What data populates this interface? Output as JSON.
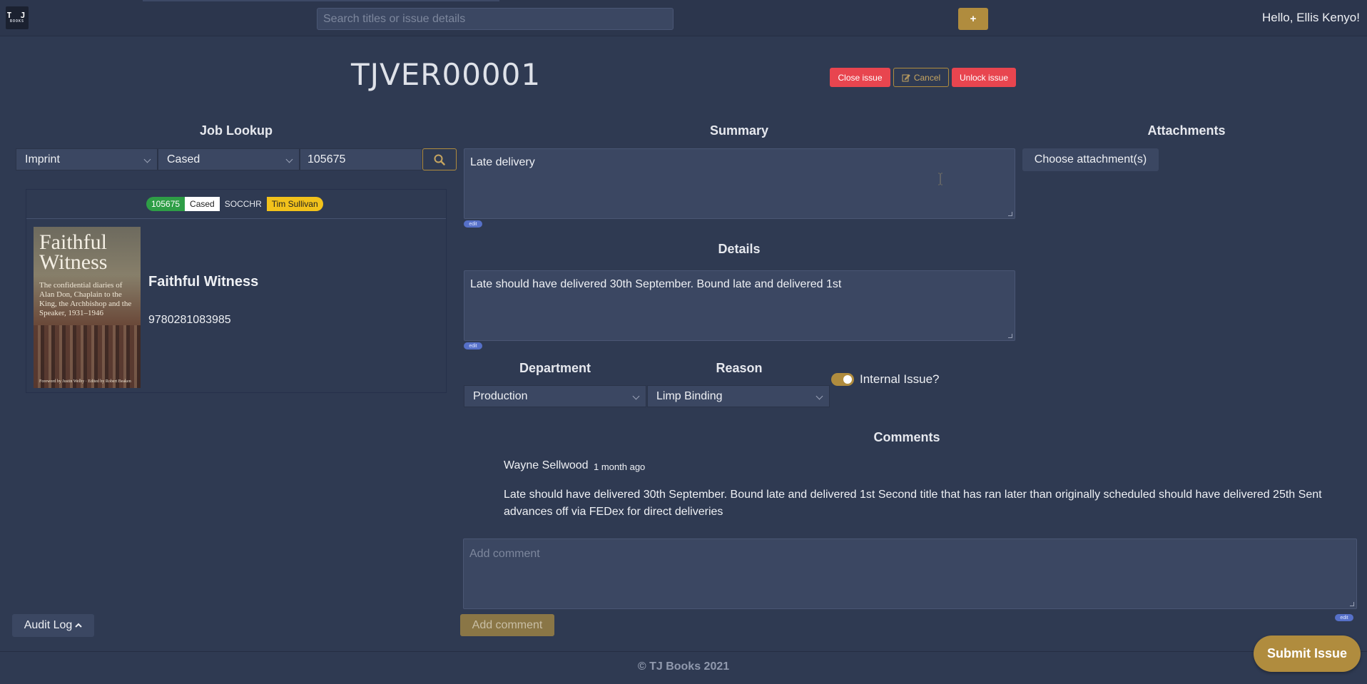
{
  "header": {
    "logo_letters": "T J",
    "logo_sub": "BOOKS",
    "search_placeholder": "Search titles or issue details",
    "add_label": "+",
    "greeting": "Hello, Ellis Kenyo!"
  },
  "issue": {
    "id": "TJVER00001",
    "actions": {
      "close": "Close issue",
      "cancel": "Cancel",
      "unlock": "Unlock issue"
    }
  },
  "job_lookup": {
    "title": "Job Lookup",
    "type_select": "Imprint",
    "binding_select": "Cased",
    "job_number": "105675",
    "badges": [
      "105675",
      "Cased",
      "SOCCHR",
      "Tim Sullivan"
    ],
    "book": {
      "title": "Faithful Witness",
      "isbn": "9780281083985",
      "cover_title": "Faithful Witness",
      "cover_subtitle": "The confidential diaries of Alan Don, Chaplain to the King, the Archbishop and the Speaker, 1931–1946",
      "cover_footer": "Foreword by Justin Welby · Edited by Robert Beaken"
    }
  },
  "summary": {
    "title": "Summary",
    "value": "Late delivery",
    "edit_label": "edit"
  },
  "details": {
    "title": "Details",
    "value": "Late should have delivered 30th September. Bound late and delivered 1st",
    "edit_label": "edit"
  },
  "attachments": {
    "title": "Attachments",
    "button": "Choose attachment(s)"
  },
  "department": {
    "title": "Department",
    "value": "Production"
  },
  "reason": {
    "title": "Reason",
    "value": "Limp Binding"
  },
  "internal_issue": {
    "label": "Internal Issue?",
    "checked": true
  },
  "comments": {
    "title": "Comments",
    "items": [
      {
        "author": "Wayne Sellwood",
        "time": "1 month ago",
        "text": "Late should have delivered 30th September. Bound late and delivered 1st Second title that has ran later than originally scheduled should have delivered 25th Sent advances off via FEDex for direct deliveries"
      }
    ],
    "placeholder": "Add comment",
    "edit_label": "edit",
    "add_button": "Add comment"
  },
  "audit_log": {
    "label": "Audit Log"
  },
  "submit": {
    "label": "Submit Issue"
  },
  "footer": {
    "text": "© TJ Books 2021"
  },
  "colors": {
    "background": "#2f3a52",
    "accent": "#b08c3e",
    "danger": "#e8454f",
    "input": "#3b4762"
  }
}
